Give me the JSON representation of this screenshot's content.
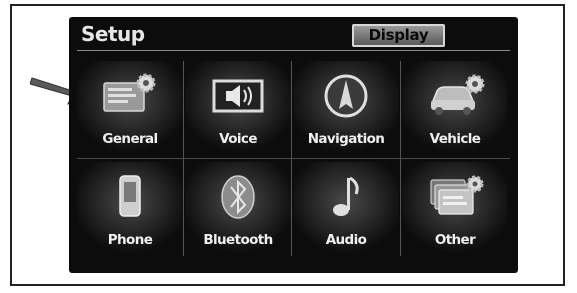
{
  "screen": {
    "title": "Setup",
    "display_button_label": "Display"
  },
  "menu": {
    "items": [
      {
        "label": "General",
        "icon": "general-settings-icon"
      },
      {
        "label": "Voice",
        "icon": "speaker-icon"
      },
      {
        "label": "Navigation",
        "icon": "compass-icon"
      },
      {
        "label": "Vehicle",
        "icon": "car-settings-icon"
      },
      {
        "label": "Phone",
        "icon": "phone-icon"
      },
      {
        "label": "Bluetooth",
        "icon": "bluetooth-icon"
      },
      {
        "label": "Audio",
        "icon": "music-note-icon"
      },
      {
        "label": "Other",
        "icon": "other-settings-icon"
      }
    ]
  },
  "colors": {
    "screen_background": "#0c0c0c",
    "label_text": "#f0f0f0",
    "icon_light": "#cfcfcf"
  }
}
